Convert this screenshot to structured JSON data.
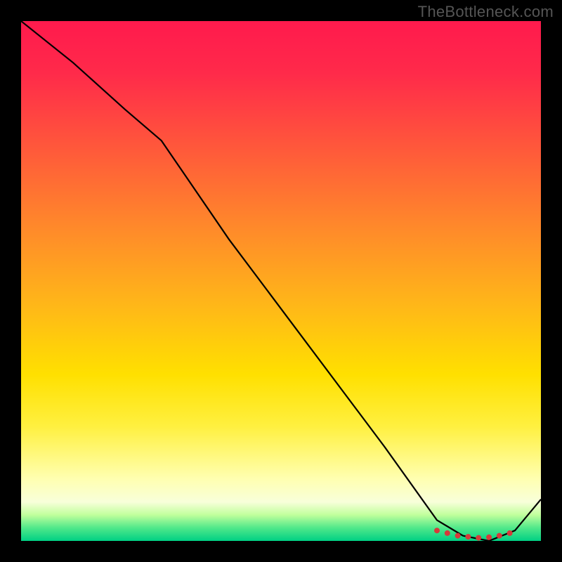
{
  "watermark": "TheBottleneck.com",
  "chart_data": {
    "type": "line",
    "title": "",
    "xlabel": "",
    "ylabel": "",
    "xlim": [
      0,
      100
    ],
    "ylim": [
      0,
      100
    ],
    "x": [
      0,
      10,
      20,
      27,
      40,
      55,
      70,
      80,
      85,
      90,
      95,
      100
    ],
    "values": [
      100,
      92,
      83,
      77,
      58,
      38,
      18,
      4,
      1,
      0,
      2,
      8
    ],
    "markers": {
      "x": [
        80,
        82,
        84,
        86,
        88,
        90,
        92,
        94
      ],
      "values": [
        2,
        1.5,
        1,
        0.8,
        0.6,
        0.7,
        1,
        1.5
      ],
      "color": "#d63a3a"
    },
    "line_color": "#000000",
    "background_gradient": {
      "top": "#ff1a4d",
      "mid": "#ffe000",
      "bottom": "#00d084"
    }
  }
}
